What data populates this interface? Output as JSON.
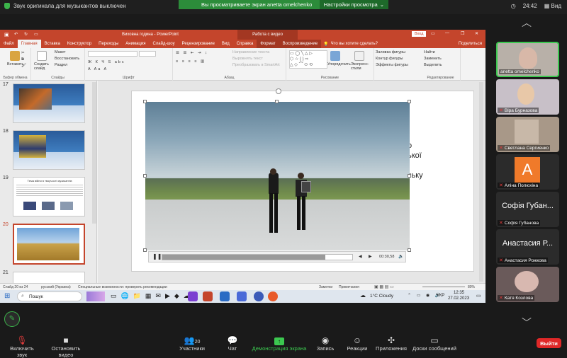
{
  "topbar": {
    "original_sound": "Звук оригинала для музыкантов выключен",
    "viewing_banner": "Вы просматриваете экран anetta omelchenko",
    "view_settings": "Настройки просмотра",
    "time": "24:42",
    "view": "Вид"
  },
  "ppt": {
    "title": "Виховна година  -  PowerPoint",
    "context_title": "Работа с видео",
    "signin": "Вход",
    "tabs": [
      "Файл",
      "Главная",
      "Вставка",
      "Конструктор",
      "Переходы",
      "Анимация",
      "Слайд-шоу",
      "Рецензирование",
      "Вид",
      "Справка",
      "Формат",
      "Воспроизведение"
    ],
    "tell_me": "Что вы хотите сделать?",
    "share": "Поделиться",
    "ribbon": {
      "paste": "Вставить",
      "create_slide": "Создать слайд",
      "layout": "Макет",
      "reset": "Восстановить",
      "section": "Раздел",
      "clipboard": "Буфер обмена",
      "slides": "Слайды",
      "font": "Шрифт",
      "paragraph": "Абзац",
      "text_direction": "Направление текста",
      "align_text": "Выровнять текст",
      "smartart": "Преобразовать в SmartArt",
      "arrange": "Упорядочить",
      "quick_styles": "Экспресс-стили",
      "drawing": "Рисование",
      "shape_fill": "Заливка фигуры",
      "shape_outline": "Контур фигуры",
      "shape_effects": "Эффекты фигуры",
      "find": "Найти",
      "replace": "Заменить",
      "select": "Выделить",
      "editing": "Редактирование"
    },
    "slides": [
      {
        "num": "17"
      },
      {
        "num": "18"
      },
      {
        "num": "19",
        "title": "Тема війни в творчості музикантів"
      },
      {
        "num": "20"
      },
      {
        "num": "21"
      }
    ],
    "slide_text": [
      "о",
      "ької",
      "ську"
    ],
    "video_time": "00:30,58",
    "status": {
      "slide": "Слайд 20 из 24",
      "lang": "русский (Украина)",
      "accessibility": "Специальные возможности: проверить рекомендации",
      "notes": "Заметки",
      "comments": "Примечания",
      "zoom": "80%"
    },
    "taskbar": {
      "search": "Пошук",
      "weather": "1°C  Cloudy",
      "lang": "УКР",
      "time": "12:35",
      "date": "27.02.2023"
    }
  },
  "gallery": [
    {
      "name": "anetta omelchenko"
    },
    {
      "name": "Віра Бурназова"
    },
    {
      "name": "Светлана Сергиенко"
    },
    {
      "name": "Аліна Полюхіна",
      "initial": "А"
    },
    {
      "name": "Софія Губанова",
      "big": "Софія Губан..."
    },
    {
      "name": "Анастасия Рожкова",
      "big": "Анастасия Р..."
    },
    {
      "name": "Катя Козлова"
    }
  ],
  "toolbar": {
    "mute": "Включить звук",
    "video": "Остановить видео",
    "participants": "Участники",
    "participants_count": "20",
    "chat": "Чат",
    "share": "Демонстрация экрана",
    "record": "Запись",
    "reactions": "Реакции",
    "apps": "Приложения",
    "whiteboard": "Доски сообщений",
    "leave": "Выйти"
  },
  "colors": {
    "ppt_accent": "#c4452c",
    "zoom_green": "#2c8c3a",
    "leave_red": "#e02828"
  }
}
